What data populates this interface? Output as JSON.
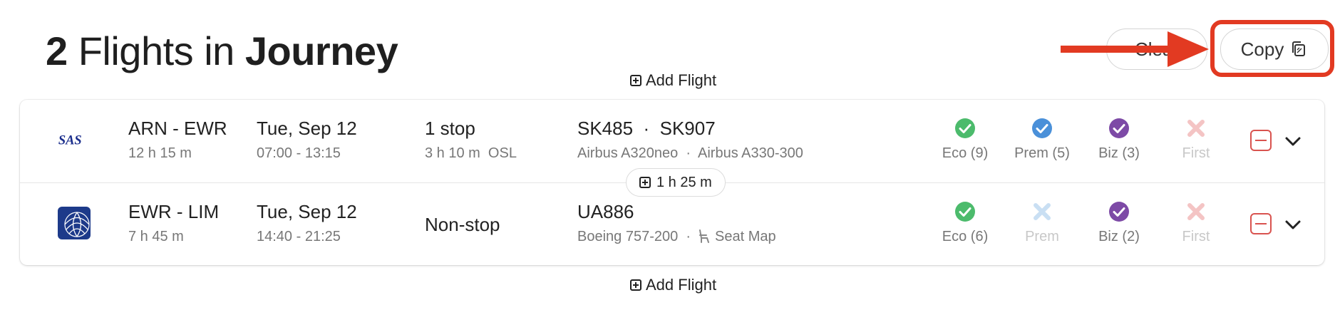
{
  "header": {
    "count": "2",
    "middle": " Flights in ",
    "bold": "Journey",
    "clear_label": "Clear",
    "copy_label": "Copy"
  },
  "add_flight_label": "Add Flight",
  "colors": {
    "accent_red": "#e23a22",
    "green": "#4cbb6c",
    "blue": "#4a90d9",
    "purple": "#7d4aa6",
    "remove": "#d9534f"
  },
  "flights": [
    {
      "airline": "SAS",
      "route": "ARN - EWR",
      "duration": "12 h 15 m",
      "date": "Tue, Sep 12",
      "times": "07:00 - 13:15",
      "stops": "1 stop",
      "stops_detail": "3 h 10 m  OSL",
      "flight_numbers": "SK485  ·  SK907",
      "aircraft": "Airbus A320neo  ·  Airbus A330-300",
      "cabins": [
        {
          "label": "Eco (9)",
          "status": "available",
          "icon": "green-check-icon"
        },
        {
          "label": "Prem (5)",
          "status": "available",
          "icon": "blue-check-icon"
        },
        {
          "label": "Biz (3)",
          "status": "available",
          "icon": "purple-check-icon"
        },
        {
          "label": "First",
          "status": "unavailable",
          "icon": "x-icon"
        }
      ]
    },
    {
      "airline": "United",
      "route": "EWR - LIM",
      "duration": "7 h 45 m",
      "date": "Tue, Sep 12",
      "times": "14:40 - 21:25",
      "stops": "Non-stop",
      "flight_numbers": "UA886",
      "aircraft": "Boeing 757-200  ·",
      "seat_map": "Seat Map",
      "cabins": [
        {
          "label": "Eco (6)",
          "status": "available",
          "icon": "green-check-icon"
        },
        {
          "label": "Prem",
          "status": "unavailable",
          "icon": "x-icon"
        },
        {
          "label": "Biz (2)",
          "status": "available",
          "icon": "purple-check-icon"
        },
        {
          "label": "First",
          "status": "unavailable",
          "icon": "x-icon"
        }
      ]
    }
  ],
  "layover": "1 h 25 m"
}
